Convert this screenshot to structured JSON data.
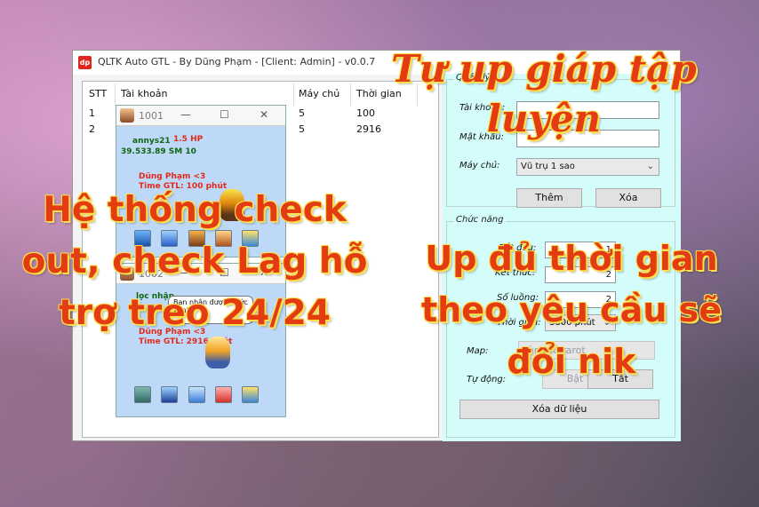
{
  "window": {
    "title": "QLTK Auto GTL - By Dũng Phạm - [Client: Admin] - v0.0.7",
    "logo_text": "dp"
  },
  "table": {
    "headers": [
      "STT",
      "Tài khoản",
      "Máy chủ",
      "Thời gian"
    ],
    "rows": [
      {
        "stt": "1",
        "server": "5",
        "time": "100"
      },
      {
        "stt": "2",
        "server": "5",
        "time": "2916"
      }
    ]
  },
  "account_group": {
    "legend": "Quản lý",
    "username_label": "Tài khoản:",
    "username_value": "",
    "password_label": "Mật khẩu:",
    "password_value": "",
    "server_label": "Máy chủ:",
    "server_value": "Vũ trụ 1 sao",
    "add_button": "Thêm",
    "delete_button": "Xóa"
  },
  "function_group": {
    "legend": "Chức năng",
    "start_label": "Bắt đầu:",
    "start_value": "1",
    "end_label": "Kết thúc:",
    "end_value": "2",
    "threads_label": "Số luồng:",
    "threads_value": "2",
    "time_label": "Thời gian:",
    "time_value": "3000 phút",
    "map_label": "Map:",
    "map_value": "Làng Kararot",
    "auto_label": "Tự động:",
    "on_button": "Bật",
    "off_button": "Tắt",
    "clear_button": "Xóa dữ liệu"
  },
  "game_windows": [
    {
      "id": "1001",
      "name_line": "annys21",
      "stat_line": "39.533.89 SM 10",
      "hp_tag": "1.5 HP",
      "owner_line": "Dũng Phạm <3",
      "time_line": "Time GTL: 100 phút"
    },
    {
      "id": "1002",
      "name_line": "lọc nhập",
      "bubble_text": "Bạn nhận được 1 sức xanh",
      "owner_line": "Dũng Phạm <3",
      "time_line": "Time GTL: 2916 phút"
    }
  ],
  "overlays": {
    "top_right": "Tự up giáp tập luyện",
    "left": "Hệ thống check out, check Lag hỗ trợ treo 24/24",
    "right": "Up đủ thời gian theo yêu cầu sẽ đổi nik"
  },
  "colors": {
    "overlay_text": "#e33b12",
    "overlay_outline": "#fbe04d",
    "panel_bg": "#d4fcfb",
    "game_bg": "#bdd9f7",
    "logo_bg": "#e0261c"
  }
}
